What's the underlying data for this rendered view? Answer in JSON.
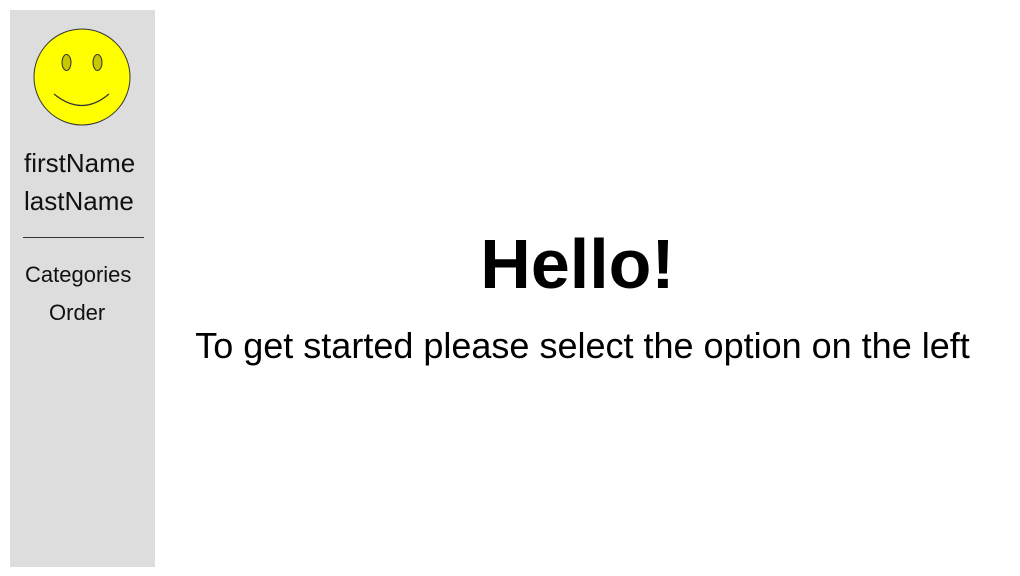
{
  "sidebar": {
    "avatar_icon": "smiley-face-icon",
    "avatar_color": "#ffff00",
    "first_name": "firstName",
    "last_name": "lastName",
    "menu": [
      {
        "label": "Categories"
      },
      {
        "label": "Order"
      }
    ],
    "background": "#dddddd"
  },
  "main": {
    "heading": "Hello!",
    "subtitle": "To get started please select the option on the left"
  }
}
